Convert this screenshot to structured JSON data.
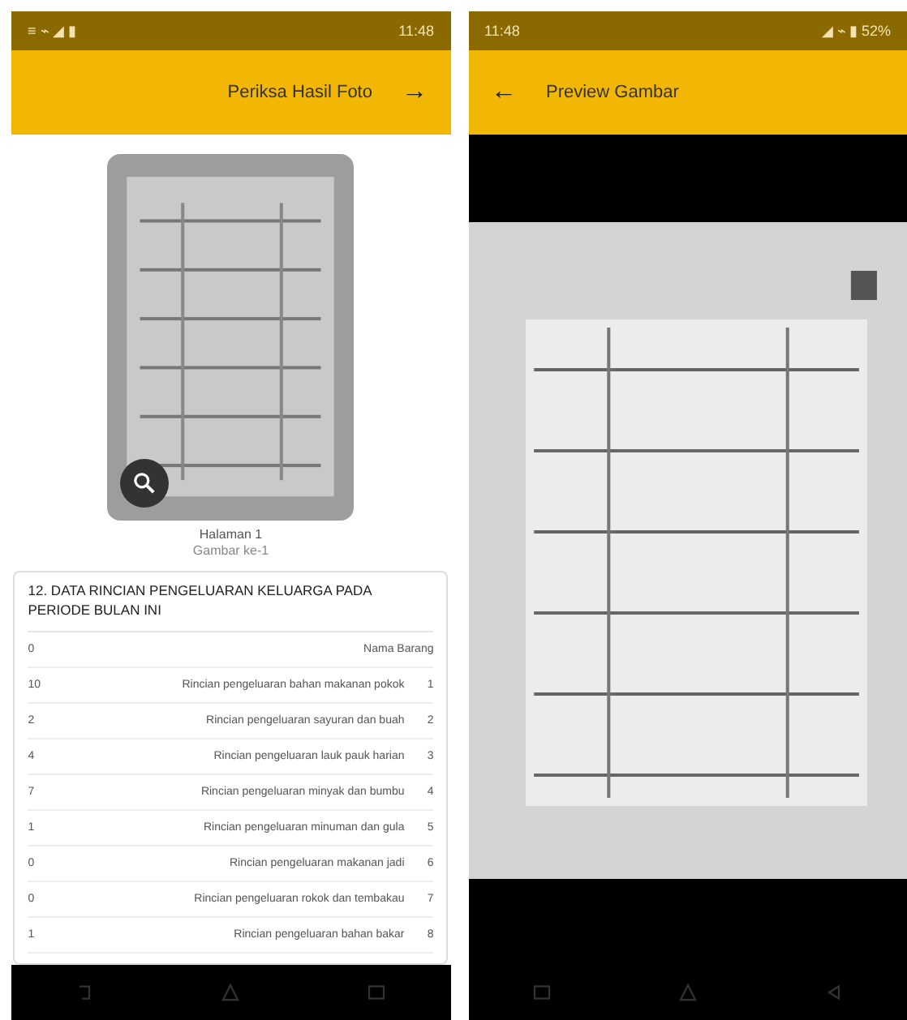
{
  "left_screen": {
    "status_bar": {
      "time": "11:48",
      "icons_text": "≡ ⌁ ◢ ▮"
    },
    "toolbar": {
      "title": "Periksa Hasil Foto",
      "forward": "→"
    },
    "photo": {
      "kind": "picture",
      "file_name": "Halaman 1",
      "subtitle": "Gambar ke-1"
    },
    "form": {
      "title": "12. DATA RINCIAN PENGELUARAN KELUARGA PADA PERIODE BULAN INI",
      "header": {
        "label": "Nama Barang",
        "number": "0"
      },
      "rows": [
        {
          "no": "1",
          "text": "Rincian pengeluaran bahan makanan pokok",
          "value": "10"
        },
        {
          "no": "2",
          "text": "Rincian pengeluaran sayuran dan buah",
          "value": "2"
        },
        {
          "no": "3",
          "text": "Rincian pengeluaran lauk pauk harian",
          "value": "4"
        },
        {
          "no": "4",
          "text": "Rincian pengeluaran minyak dan bumbu",
          "value": "7"
        },
        {
          "no": "5",
          "text": "Rincian pengeluaran minuman dan gula",
          "value": "1"
        },
        {
          "no": "6",
          "text": "Rincian pengeluaran makanan jadi",
          "value": "0"
        },
        {
          "no": "7",
          "text": "Rincian pengeluaran rokok dan tembakau",
          "value": "0"
        },
        {
          "no": "8",
          "text": "Rincian pengeluaran bahan bakar",
          "value": "1"
        }
      ]
    }
  },
  "right_screen": {
    "status_bar": {
      "time": "11:48",
      "icons_text": "◢ ⌁ ▮ 52%"
    },
    "toolbar": {
      "back": "←",
      "title": "Preview Gambar"
    }
  }
}
